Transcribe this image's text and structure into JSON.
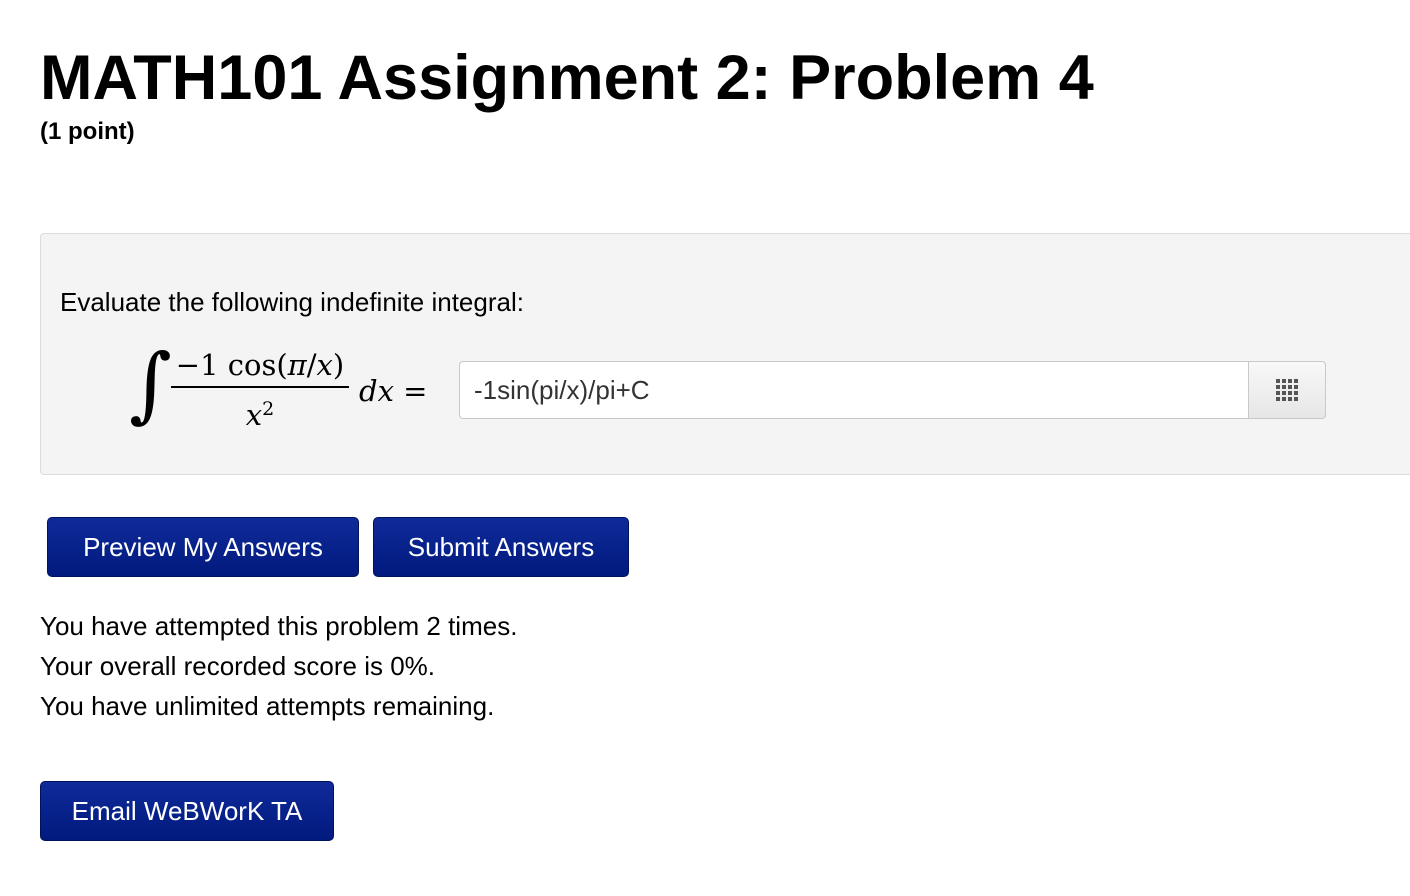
{
  "header": {
    "title": "MATH101 Assignment 2: Problem 4",
    "points": "(1 point)"
  },
  "problem": {
    "prompt": "Evaluate the following indefinite integral:",
    "math": {
      "integral_sign": "∫",
      "numerator_coef": "−1",
      "numerator_func": "cos",
      "numerator_open": "(",
      "numerator_pi": "π",
      "numerator_slash": "/",
      "numerator_x": "x",
      "numerator_close": ")",
      "denominator_base": "x",
      "denominator_exp": "2",
      "differential": "dx",
      "equals": "="
    },
    "answer_value": "-1sin(pi/x)/pi+C",
    "palette_icon": "grid-icon"
  },
  "buttons": {
    "preview": "Preview My Answers",
    "submit": "Submit Answers",
    "email": "Email WeBWorK TA"
  },
  "status": {
    "attempts": "You have attempted this problem 2 times.",
    "score": "Your overall recorded score is 0%.",
    "remaining": "You have unlimited attempts remaining."
  },
  "colors": {
    "button_bg": "#0a2290",
    "problem_bg": "#f4f4f4"
  }
}
